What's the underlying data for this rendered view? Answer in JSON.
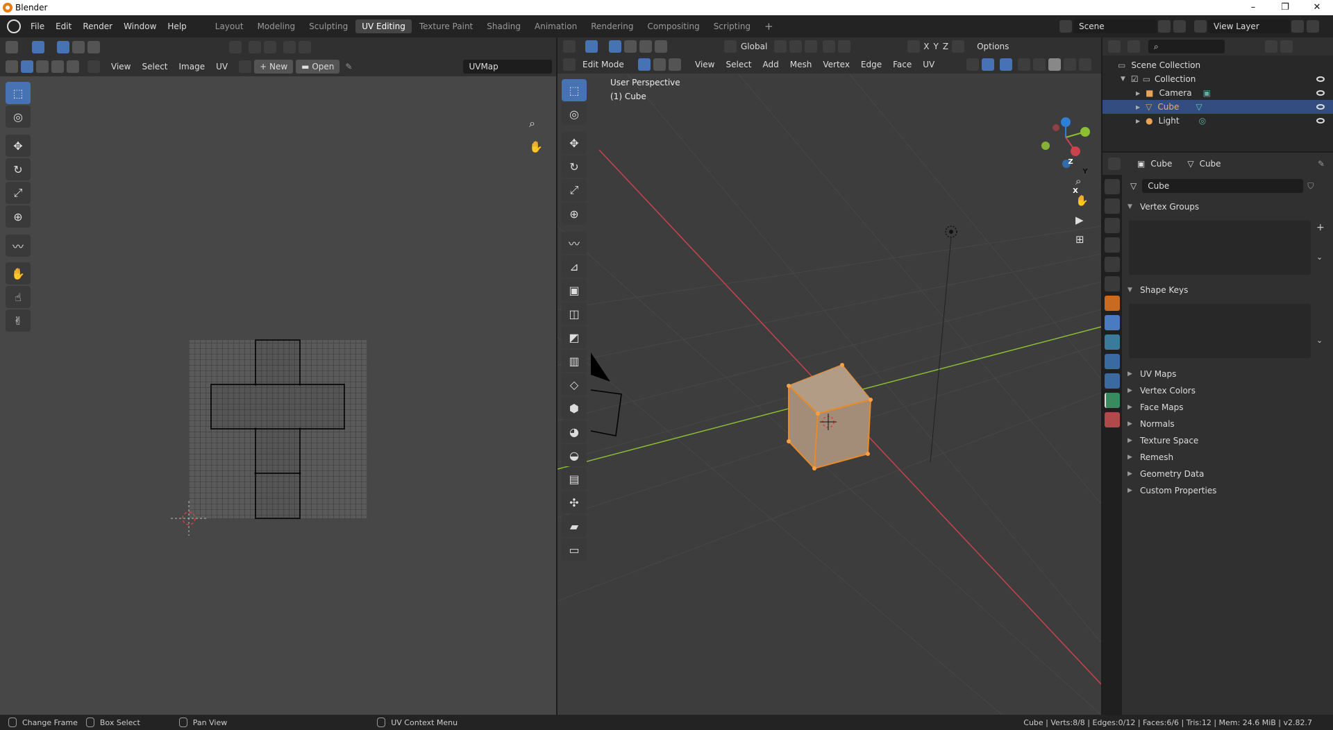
{
  "window": {
    "title": "Blender",
    "controls": [
      "–",
      "❐",
      "✕"
    ]
  },
  "menubar": {
    "menus": [
      "File",
      "Edit",
      "Render",
      "Window",
      "Help"
    ],
    "workspaces": [
      "Layout",
      "Modeling",
      "Sculpting",
      "UV Editing",
      "Texture Paint",
      "Shading",
      "Animation",
      "Rendering",
      "Compositing",
      "Scripting"
    ],
    "active_workspace": "UV Editing",
    "add_tab": "+",
    "scene_label": "Scene",
    "view_layer_label": "View Layer"
  },
  "uv_editor": {
    "menus": [
      "View",
      "Select",
      "Image",
      "UV"
    ],
    "new_label": "New",
    "open_label": "Open",
    "uvmap_field": "UVMap"
  },
  "viewport": {
    "mode": "Edit Mode",
    "menus": [
      "View",
      "Select",
      "Add",
      "Mesh",
      "Vertex",
      "Edge",
      "Face",
      "UV"
    ],
    "orientation": "Global",
    "options_label": "Options",
    "overlay_title": "User Perspective",
    "overlay_object": "(1) Cube",
    "axis_labels": [
      "Z",
      "Y",
      "X"
    ],
    "axis_toggles": [
      "X",
      "Y",
      "Z"
    ]
  },
  "outliner": {
    "search_placeholder": "",
    "rows": [
      {
        "label": "Scene Collection"
      },
      {
        "label": "Collection"
      },
      {
        "label": "Camera"
      },
      {
        "label": "Cube"
      },
      {
        "label": "Light"
      }
    ]
  },
  "properties": {
    "breadcrumb_object": "Cube",
    "breadcrumb_data": "Cube",
    "data_name": "Cube",
    "panels": {
      "vertex_groups": "Vertex Groups",
      "shape_keys": "Shape Keys",
      "collapsed": [
        "UV Maps",
        "Vertex Colors",
        "Face Maps",
        "Normals",
        "Texture Space",
        "Remesh",
        "Geometry Data",
        "Custom Properties"
      ]
    }
  },
  "statusbar": {
    "change_frame": "Change Frame",
    "box_select": "Box Select",
    "pan_view": "Pan View",
    "uv_context_menu": "UV Context Menu",
    "stats": "Cube | Verts:8/8 | Edges:0/12 | Faces:6/6 | Tris:12 | Mem: 24.6 MiB | v2.82.7"
  },
  "colors": {
    "accent": "#4772b3",
    "selection_orange": "#e88a26",
    "x_axis": "#c9434c",
    "y_axis": "#8dbf33",
    "z_axis": "#2e7fd8"
  }
}
